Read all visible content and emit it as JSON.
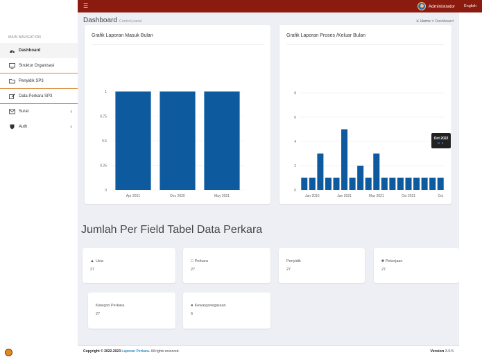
{
  "topbar": {
    "menu_icon": "hamburger-icon",
    "user_name": "Administrator",
    "lang_label": "English",
    "bar_color": "#8b1a0f"
  },
  "sidebar": {
    "header": "MAIN NAVIGATION",
    "items": [
      {
        "label": "Dashboard",
        "icon": "dashboard-icon"
      },
      {
        "label": "Struktur Organisasi",
        "icon": "monitor-icon"
      },
      {
        "label": "Penyidik SP3",
        "icon": "folder-icon"
      },
      {
        "label": "Data Perkara SP3",
        "icon": "edit-icon"
      },
      {
        "label": "Surat",
        "icon": "envelope-icon"
      },
      {
        "label": "Auth",
        "icon": "shield-icon"
      }
    ]
  },
  "header": {
    "title": "Dashboard",
    "subtitle": "Control panel",
    "breadcrumb_home": "Home",
    "breadcrumb_sep": ">",
    "breadcrumb_current": "Dashboard"
  },
  "chart_data": [
    {
      "type": "bar",
      "title": "Grafik Laporan Masuk Bulan",
      "categories": [
        "Apr 2021",
        "Dec 2020",
        "May 2021"
      ],
      "values": [
        1,
        1,
        1
      ],
      "ylim": [
        0,
        1
      ],
      "yticks": [
        "0",
        "0.25",
        "0.5",
        "0.75",
        "1"
      ],
      "color": "#0e5a9e"
    },
    {
      "type": "bar",
      "title": "Grafik Laporan Proses /Keluar Bulan",
      "values": [
        1,
        1,
        3,
        1,
        1,
        5,
        1,
        2,
        1,
        3,
        1,
        1,
        1,
        1,
        1,
        1,
        1,
        1
      ],
      "xticks": [
        "Jan 2016",
        "Jan 2021",
        "May 2021",
        "Oct 2021",
        "Oct"
      ],
      "ylim": [
        0,
        8
      ],
      "yticks": [
        "0",
        "2",
        "4",
        "6",
        "8"
      ],
      "color": "#0e5a9e",
      "tooltip_title": "Oct 2022",
      "tooltip_value": "1"
    }
  ],
  "section_title": "Jumlah Per Field Tabel Data Perkara",
  "stats": [
    {
      "label": "Usia",
      "value": "27",
      "icon": "user-icon"
    },
    {
      "label": "Perkara",
      "value": "27",
      "icon": "folder-icon"
    },
    {
      "label": "Penyidik",
      "value": "27",
      "icon": ""
    },
    {
      "label": "Pekerjaan",
      "value": "27",
      "icon": "briefcase-icon"
    },
    {
      "label": "Kategori Perkara",
      "value": "27",
      "icon": ""
    },
    {
      "label": "Kewarganegaraan",
      "value": "6",
      "icon": "globe-icon"
    }
  ],
  "footer": {
    "copyright": "Copyright © 2022-2023",
    "link": "Laporan Perkara.",
    "rest": "All rights reserved.",
    "version_label": "Version",
    "version": "3.0.5"
  }
}
